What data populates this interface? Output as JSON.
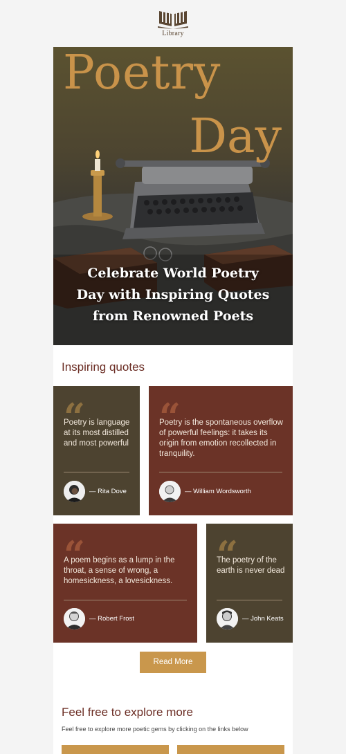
{
  "brand": {
    "logo_text": "Library"
  },
  "hero": {
    "title_line1": "Poetry",
    "title_line2": "Day",
    "caption_line1": "Celebrate World Poetry",
    "caption_line2": "Day with Inspiring Quotes",
    "caption_line3": "from Renowned Poets"
  },
  "quotes_section": {
    "title": "Inspiring quotes",
    "cards": [
      {
        "text": "Poetry is language at its most distilled and most powerful",
        "author": "— Rita Dove"
      },
      {
        "text": "Poetry is the spontaneous overflow of powerful feelings: it takes its origin from emotion recollected in tranquility.",
        "author": "— William Wordsworth"
      },
      {
        "text": "A poem begins as a lump in the throat, a sense of wrong, a homesickness, a lovesickness.",
        "author": "— Robert Frost"
      },
      {
        "text": "The poetry of the earth is never dead",
        "author": "— John Keats"
      }
    ],
    "read_more_label": "Read More"
  },
  "explore": {
    "title": "Feel free to explore more",
    "subtitle": "Feel free to explore more poetic gems by clicking on the links below"
  },
  "colors": {
    "accent_gold": "#c9974c",
    "card_dark": "#4d4330",
    "card_red": "#6b3327",
    "heading": "#6b2d24"
  }
}
